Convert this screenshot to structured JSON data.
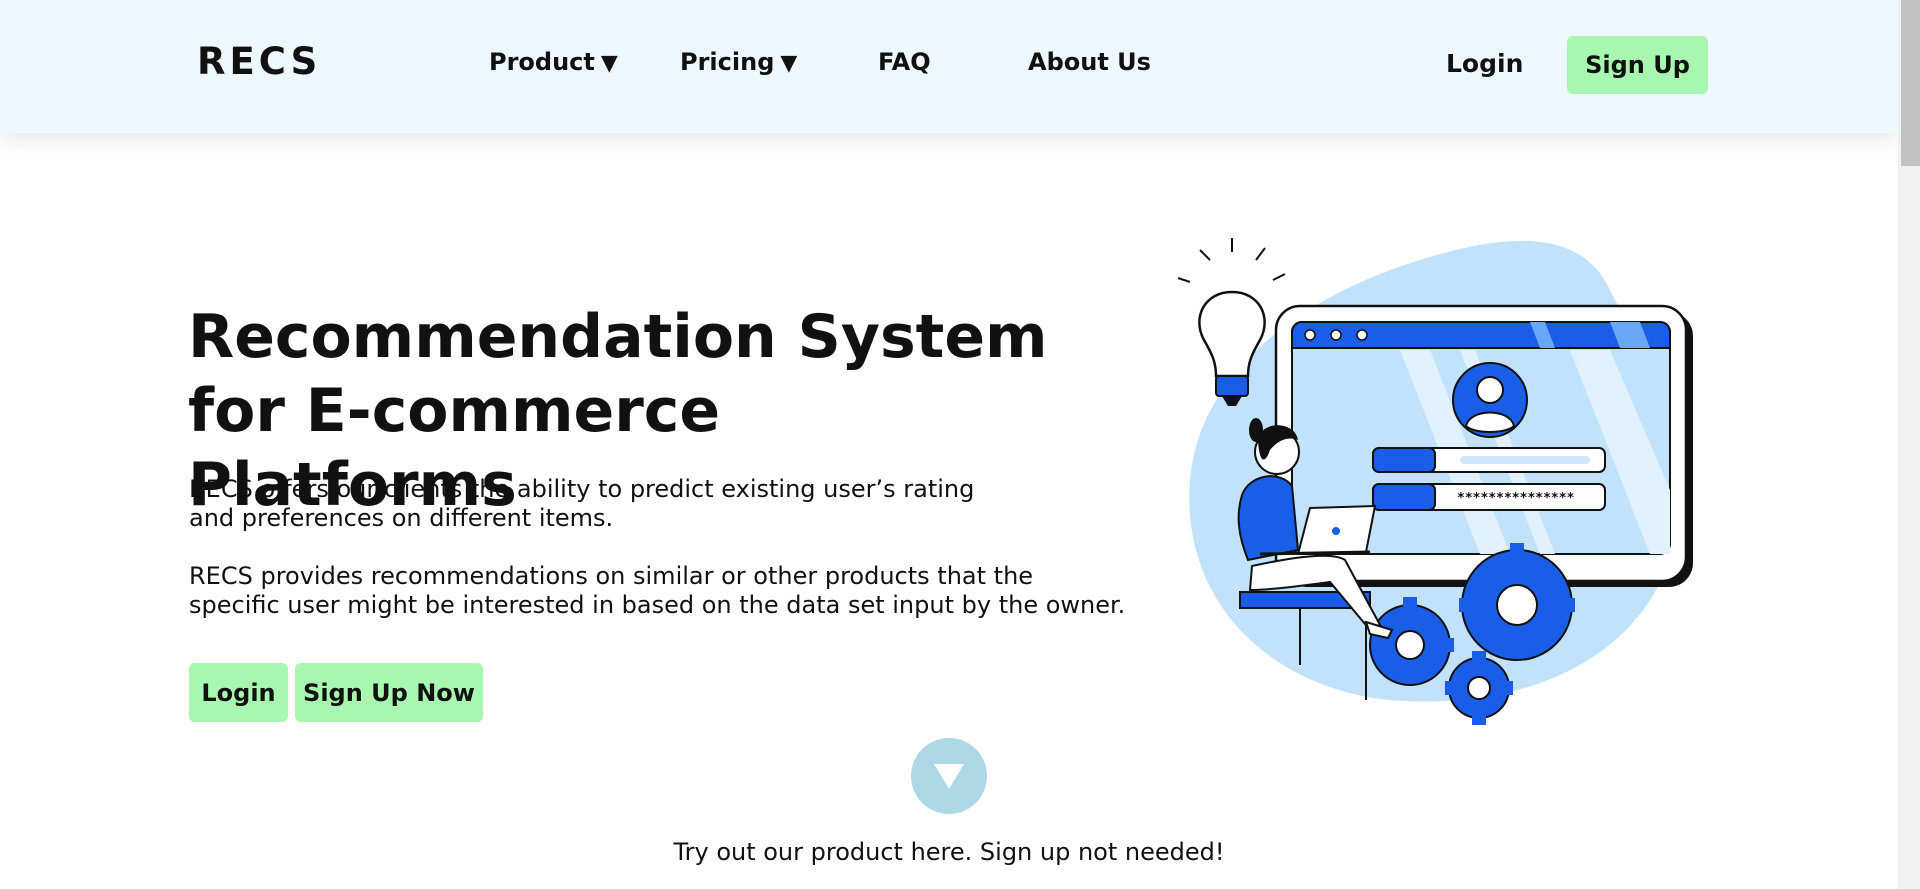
{
  "header": {
    "logo": "RECS",
    "nav": [
      {
        "label": "Product",
        "has_dropdown": true,
        "caret": "▼"
      },
      {
        "label": "Pricing",
        "has_dropdown": true,
        "caret": "▼"
      },
      {
        "label": "FAQ",
        "has_dropdown": false
      },
      {
        "label": "About Us",
        "has_dropdown": false
      }
    ],
    "login_label": "Login",
    "signup_label": "Sign Up"
  },
  "hero": {
    "title_line1": "Recommendation System",
    "title_line2": "for E-commerce Platforms",
    "paragraph1_line1": "RECS offers our clients the ability to predict existing user’s rating",
    "paragraph1_line2": "and preferences on different items.",
    "paragraph2_line1": "RECS provides recommendations on similar or other products that the",
    "paragraph2_line2": "specific user might be interested in based on the data set input by the owner.",
    "login_label": "Login",
    "signup_label": "Sign Up Now"
  },
  "illustration": {
    "password_mask": "***************",
    "icons": [
      "lightbulb-icon",
      "user-avatar-icon",
      "gear-icon",
      "laptop-icon"
    ]
  },
  "scroll_down": {
    "icon": "triangle-down-icon"
  },
  "tryout_text": "Try out our product here. Sign up not needed!",
  "colors": {
    "header_bg": "#eef6fe",
    "accent_green": "#a7f7b0",
    "illustration_blue": "#1a5ee8",
    "illustration_light": "#c2e2fb",
    "scroll_circle": "#add8e6"
  }
}
